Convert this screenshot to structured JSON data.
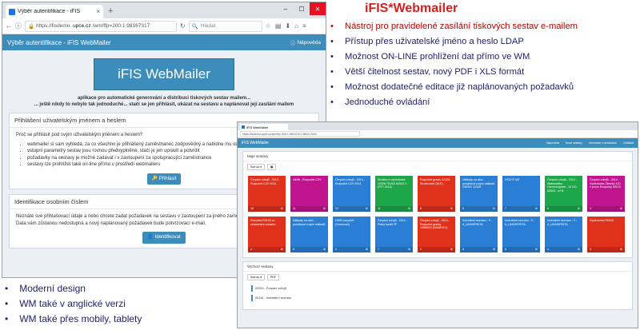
{
  "browser": {
    "tab_title": "Výběr autentifikace - iFIS",
    "tab_close": "×",
    "new_tab": "+",
    "window_controls": [
      "–",
      "☐",
      "✕"
    ],
    "url_prefix": "https://fisdemo.",
    "url_domain": "upce.cz",
    "url_suffix": "/wm/ffp=200:1:98167317",
    "search_placeholder": "Hledat"
  },
  "app": {
    "header_title": "Výběr autentifikace - iFIS WebMailer",
    "help_label": "Nápověda",
    "logo_text": "iFIS WebMailer",
    "intro_line1": "aplikace pro automatické generování a distribuci tiskových sestav mailem...",
    "intro_line2": "... ještě nikdy to nebylo tak jednoduché... stačí se jen přihlásit, ukázat na sestavu a naplánovat její zasílání mailem",
    "login_panel": {
      "heading": "Přihlášení uživatelským jménem a heslem",
      "question": "Proč se přihlásit pod svým uživatelským jménem a heslem?",
      "bullets": [
        "webmailer si sám vyhledá, za co všechno je přihlášený zaměstnanec zodpovědný a nabídne mu odp",
        "vstupní parametry sestav jsou rovnou předvyplněné, stačí je jen upravit a potvrdit",
        "požadavky na sestavy je možné zadávat i v zastoupení za spolupracující zaměstnance",
        "sestavy lze prohlížet také on-line přímo v prostředí webmaileru"
      ],
      "button": "Přihlásit"
    },
    "id_panel": {
      "heading": "Identifikace osobním číslem",
      "text": "Neznáte své přihlašovací údaje a nebo chcete zadat požadavek na sestavu v zastoupení za jiného zamě webmaileru pod osobním číslem. Data vám zůstanou nedostupná a nový naplánovaný požadavek bude potvrzovací e-mail.",
      "button": "Identifikovat"
    }
  },
  "title": "iFIS*Webmailer",
  "features": [
    {
      "text": "Nástroj pro pravidelené zasílání tiskových sestav e-mailem",
      "color": "#c00000"
    },
    {
      "text": "Přístup přes uživatelské jméno a heslo LDAP",
      "color": "#1f1f6b"
    },
    {
      "text": "Možnost ON-LINE prohlížení dat přímo ve WM",
      "color": "#1f1f6b"
    },
    {
      "text": "Větší čitelnost sestav, nový PDF i XLS formát",
      "color": "#1f1f6b"
    },
    {
      "text": "Možnost dodatečné editace již naplánovaných požadavků",
      "color": "#1f1f6b"
    },
    {
      "text": "Jednoduché ovládání",
      "color": "#1f1f6b"
    }
  ],
  "bottom_bullets": [
    "Moderní design",
    "WM také v anglické verzi",
    "WM také přes mobily, tablety"
  ],
  "second_window": {
    "tab_title": "iFIS WebMailer",
    "url": "https://fisdemo.upce.cz/wm/ffp=200:1:98167317:98421:900/",
    "header_title": "iFIS WebMailer",
    "nav": [
      "Nápověda",
      "Nové sestavy",
      "Informace o sestavách",
      "Odhlásit"
    ],
    "section1_heading": "Moje sestavy",
    "section2_heading": "Výchozí sestavy",
    "sort_label": "Sort do ▾",
    "tiles": [
      {
        "label": "Čerpání zdrojů - 2014 - Rozpočet CZV 2014",
        "count": "16",
        "color": "#e0311c"
      },
      {
        "label": "nikHit - Rozpočet CZV",
        "count": "11",
        "color": "#c0158f"
      },
      {
        "label": "Čerpání zdrojů - 2014 - Rozpočet CZV 2014",
        "count": "23",
        "color": "#2a7fd4"
      },
      {
        "label": "Strukturní výsledovka 12328 75-002 MZM1 0 (FIFI 2014)",
        "count": "11",
        "color": "#1ea64a"
      },
      {
        "label": "Rozpočet grantu 12328 Strukturální (NLE)",
        "count": "8",
        "color": "#e0311c"
      },
      {
        "label": "Náklady na akci - položková rozpis nákladů GNR01 12328",
        "count": "5",
        "color": "#2a7fd4"
      },
      {
        "label": "VSCHT M3",
        "count": "7",
        "color": "#2a7fd4"
      },
      {
        "label": "Čerpání zdrojů - 2014 - Matematika Harmonogram - 10 DO MSM1 - A+B",
        "count": "6",
        "color": "#1ea64a"
      },
      {
        "label": "Čerpání zdrojů - 2014 - Výsledovka Obecky 100 v prove Rozpočty MSVS",
        "count": "3",
        "color": "#c0158f"
      },
      {
        "label": "Rozvaha R0100 ve zkráceném rozsahu",
        "count": "2",
        "color": "#e0311c"
      },
      {
        "label": "Náklady na akci - položková rozpis nákladů",
        "count": "8",
        "color": "#2a7fd4"
      },
      {
        "label": "HMM rozpočet (Hmotnost)",
        "count": "4",
        "color": "#2a7fd4"
      },
      {
        "label": "Čerpání zdrojů - 2014 - Plány fondů FF",
        "count": "7",
        "color": "#2a7fd4"
      },
      {
        "label": "Čerpání zdrojů - 2014 - Rozpočet granty 14568/02 (NUMERO)",
        "count": "2",
        "color": "#e0311c"
      },
      {
        "label": "Inventární seznam - 9 - A_UNIVERSITA",
        "count": "5",
        "color": "#2a7fd4"
      },
      {
        "label": "Inventární seznam - 9 - A_UNIVERSITA",
        "count": "6",
        "color": "#2a7fd4"
      },
      {
        "label": "Inventární seznam - 9 - A_UNIVERSITA",
        "count": "4",
        "color": "#2a7fd4"
      },
      {
        "label": "Výsledovka R0100",
        "count": "3",
        "color": "#e0311c"
      }
    ],
    "rows": [
      "00324 - Čerpání zdrojů",
      "00116 - Inventární seznam"
    ]
  }
}
